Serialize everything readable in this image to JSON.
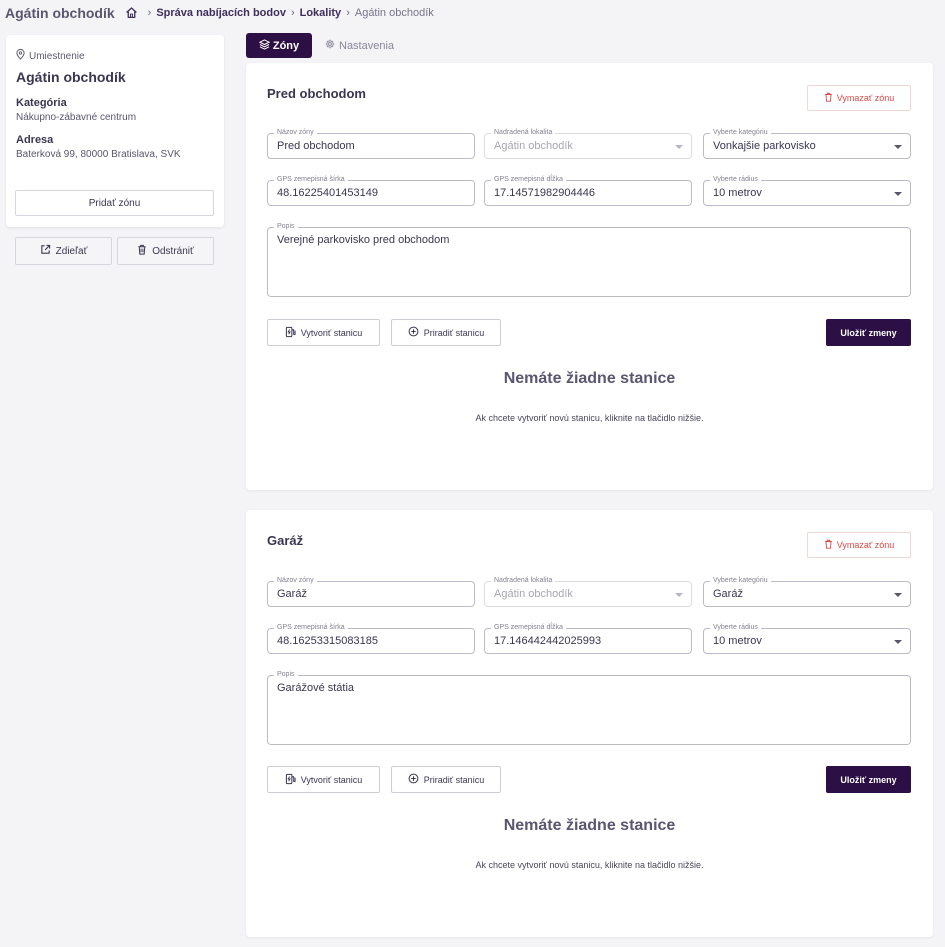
{
  "header": {
    "title": "Agátin obchodík",
    "breadcrumbs": [
      "Správa nabíjacích bodov",
      "Lokality",
      "Agátin obchodík"
    ]
  },
  "location": {
    "label": "Umiestnenie",
    "name": "Agátin obchodík",
    "category_label": "Kategória",
    "category_value": "Nákupno-zábavné centrum",
    "address_label": "Adresa",
    "address_value": "Baterková 99, 80000 Bratislava, SVK",
    "add_zone": "Pridať zónu",
    "share": "Zdieľať",
    "delete": "Odstrániť"
  },
  "tabs": [
    {
      "label": "Zóny",
      "active": true
    },
    {
      "label": "Nastavenia",
      "active": false
    }
  ],
  "colors": {
    "primary": "#2c0f45",
    "danger": "#d84a4a"
  },
  "zones": [
    {
      "title": "Pred obchodom",
      "delete_label": "Vymazať zónu",
      "name_label": "Názov zóny",
      "name_value": "Pred obchodom",
      "parent_label": "Nadradená lokalita",
      "parent_value": "Agátin obchodík",
      "category_label": "Vyberte kategóriu",
      "category_value": "Vonkajšie parkovisko",
      "lat_label": "GPS zemepisná šírka",
      "lat_value": "48.16225401453149",
      "lng_label": "GPS zemepisná dĺžka",
      "lng_value": "17.14571982904446",
      "radius_label": "Vyberte rádius",
      "radius_value": "10 metrov",
      "desc_label": "Popis",
      "desc_value": "Verejné parkovisko pred obchodom",
      "create_station": "Vytvoriť stanicu",
      "assign_station": "Priradiť stanicu",
      "save": "Uložiť zmeny",
      "empty_title": "Nemáte žiadne stanice",
      "empty_sub": "Ak chcete vytvoriť novú stanicu, kliknite na tlačidlo nižšie."
    },
    {
      "title": "Garáž",
      "delete_label": "Vymazať zónu",
      "name_label": "Názov zóny",
      "name_value": "Garáž",
      "parent_label": "Nadradená lokalita",
      "parent_value": "Agátin obchodík",
      "category_label": "Vyberte kategóriu",
      "category_value": "Garáž",
      "lat_label": "GPS zemepisná šírka",
      "lat_value": "48.16253315083185",
      "lng_label": "GPS zemepisná dĺžka",
      "lng_value": "17.146442442025993",
      "radius_label": "Vyberte rádius",
      "radius_value": "10 metrov",
      "desc_label": "Popis",
      "desc_value": "Garážové státia",
      "create_station": "Vytvoriť stanicu",
      "assign_station": "Priradiť stanicu",
      "save": "Uložiť zmeny",
      "empty_title": "Nemáte žiadne stanice",
      "empty_sub": "Ak chcete vytvoriť novú stanicu, kliknite na tlačidlo nižšie."
    }
  ]
}
